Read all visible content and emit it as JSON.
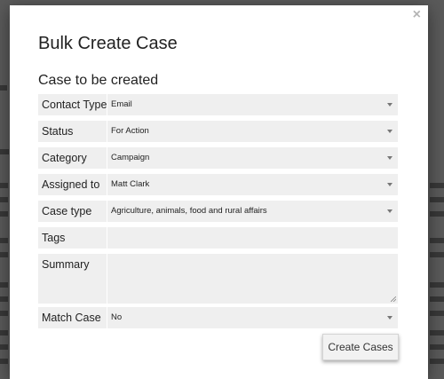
{
  "modal": {
    "close_label": "×",
    "title": "Bulk Create Case",
    "section_title": "Case to be created",
    "submit_label": "Create Cases"
  },
  "form": {
    "contact_type": {
      "label": "Contact Type",
      "value": "Email"
    },
    "status": {
      "label": "Status",
      "value": "For Action"
    },
    "category": {
      "label": "Category",
      "value": "Campaign"
    },
    "assigned_to": {
      "label": "Assigned to",
      "value": "Matt Clark"
    },
    "case_type": {
      "label": "Case type",
      "value": "Agriculture, animals, food and rural affairs"
    },
    "tags": {
      "label": "Tags",
      "value": ""
    },
    "summary": {
      "label": "Summary",
      "value": ""
    },
    "match_case": {
      "label": "Match Case",
      "value": "No"
    }
  },
  "icons": {
    "close": "close-icon",
    "caret": "chevron-down-icon",
    "resize": "resize-handle-icon"
  },
  "colors": {
    "field_background": "#efefef",
    "overlay": "#000000"
  }
}
